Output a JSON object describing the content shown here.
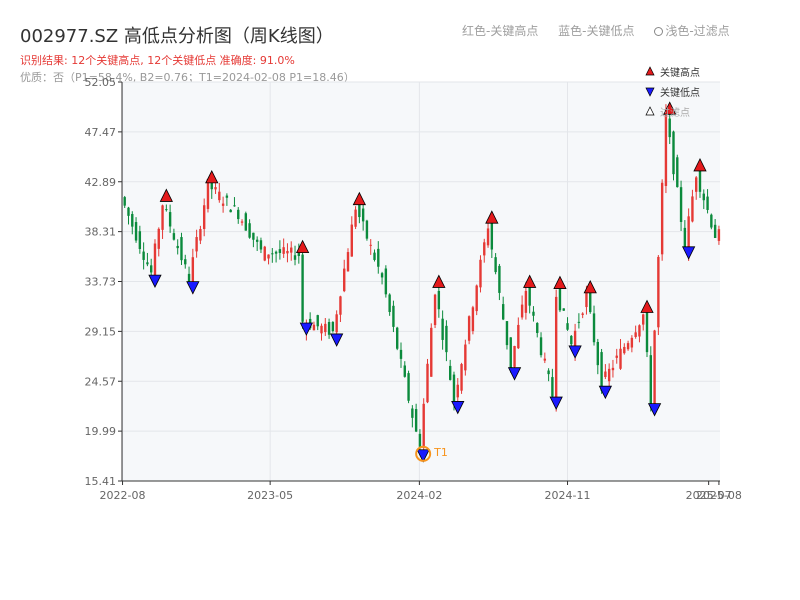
{
  "title": "002977.SZ 高低点分析图（周K线图）",
  "subtitle_result": "识别结果: 12个关键高点, 12个关键低点   准确度: 91.0%",
  "subtitle_quality": "优质：否（P1=58.4%, B2=0.76；T1=2024-02-08 P1=18.46）",
  "top_legend": {
    "red": "红色-关键高点",
    "blue": "蓝色-关键低点",
    "light": "浅色-过滤点"
  },
  "chart_data": {
    "type": "candlestick",
    "title": "002977.SZ 高低点分析图（周K线图）",
    "x_ticks": [
      "2022-08",
      "2023-05",
      "2024-02",
      "2024-11",
      "2025-07",
      "2025-08"
    ],
    "y_ticks": [
      "15.41",
      "19.99",
      "24.57",
      "29.15",
      "33.73",
      "38.31",
      "42.89",
      "47.47",
      "52.05"
    ],
    "ylim": [
      15.41,
      52.05
    ],
    "grid": true,
    "colors": {
      "up": "#e53935",
      "down": "#0b8a3c",
      "high_marker": "#e41a1c",
      "low_marker": "#1a1aff",
      "t1": "#f7941d",
      "plot_bg": "#f6f8fa"
    },
    "legend": {
      "placement": "top-right",
      "items": [
        {
          "name": "关键高点",
          "marker": "triangle-up-red"
        },
        {
          "name": "关键低点",
          "marker": "triangle-down-blue"
        },
        {
          "name": "过滤点",
          "marker": "triangle-up-hollow"
        }
      ]
    },
    "key_highs": [
      {
        "date": "2022-10-21",
        "value": 40.9
      },
      {
        "date": "2023-01-13",
        "value": 42.6
      },
      {
        "date": "2023-06-30",
        "value": 36.2
      },
      {
        "date": "2023-10-13",
        "value": 40.6
      },
      {
        "date": "2024-03-08",
        "value": 33.0
      },
      {
        "date": "2024-06-14",
        "value": 38.9
      },
      {
        "date": "2024-08-23",
        "value": 33.0
      },
      {
        "date": "2024-10-18",
        "value": 32.9
      },
      {
        "date": "2024-12-13",
        "value": 32.5
      },
      {
        "date": "2025-03-28",
        "value": 30.7
      },
      {
        "date": "2025-05-09",
        "value": 48.9
      },
      {
        "date": "2025-07-04",
        "value": 43.7
      }
    ],
    "key_lows": [
      {
        "date": "2022-09-30",
        "value": 34.5
      },
      {
        "date": "2022-12-09",
        "value": 33.9
      },
      {
        "date": "2023-07-07",
        "value": 30.1
      },
      {
        "date": "2023-09-01",
        "value": 29.1
      },
      {
        "date": "2024-02-08",
        "value": 18.46
      },
      {
        "date": "2024-04-12",
        "value": 22.9
      },
      {
        "date": "2024-07-26",
        "value": 26.0
      },
      {
        "date": "2024-10-11",
        "value": 23.3
      },
      {
        "date": "2024-11-15",
        "value": 28.0
      },
      {
        "date": "2025-01-10",
        "value": 24.3
      },
      {
        "date": "2025-04-11",
        "value": 22.7
      },
      {
        "date": "2025-06-13",
        "value": 37.1
      }
    ],
    "t1": {
      "label": "T1",
      "date": "2024-02-08",
      "value": 18.46
    },
    "anchors": [
      {
        "date": "2022-08-05",
        "value": 41.5
      },
      {
        "date": "2022-09-30",
        "value": 34.5
      },
      {
        "date": "2022-10-21",
        "value": 40.9
      },
      {
        "date": "2022-12-09",
        "value": 33.9
      },
      {
        "date": "2023-01-13",
        "value": 42.6
      },
      {
        "date": "2023-03-10",
        "value": 40.0
      },
      {
        "date": "2023-04-21",
        "value": 36.5
      },
      {
        "date": "2023-06-30",
        "value": 36.2
      },
      {
        "date": "2023-07-07",
        "value": 30.1
      },
      {
        "date": "2023-09-01",
        "value": 29.1
      },
      {
        "date": "2023-10-13",
        "value": 40.6
      },
      {
        "date": "2023-12-01",
        "value": 34.0
      },
      {
        "date": "2024-02-08",
        "value": 18.46
      },
      {
        "date": "2024-03-08",
        "value": 33.0
      },
      {
        "date": "2024-04-12",
        "value": 22.9
      },
      {
        "date": "2024-06-14",
        "value": 38.9
      },
      {
        "date": "2024-07-26",
        "value": 26.0
      },
      {
        "date": "2024-08-23",
        "value": 33.0
      },
      {
        "date": "2024-10-11",
        "value": 23.3
      },
      {
        "date": "2024-10-18",
        "value": 32.9
      },
      {
        "date": "2024-11-15",
        "value": 28.0
      },
      {
        "date": "2024-12-13",
        "value": 32.5
      },
      {
        "date": "2025-01-10",
        "value": 24.3
      },
      {
        "date": "2025-03-28",
        "value": 30.7
      },
      {
        "date": "2025-04-11",
        "value": 22.7
      },
      {
        "date": "2025-05-09",
        "value": 48.9
      },
      {
        "date": "2025-06-13",
        "value": 37.1
      },
      {
        "date": "2025-07-04",
        "value": 43.7
      },
      {
        "date": "2025-08-08",
        "value": 38.0
      }
    ]
  }
}
